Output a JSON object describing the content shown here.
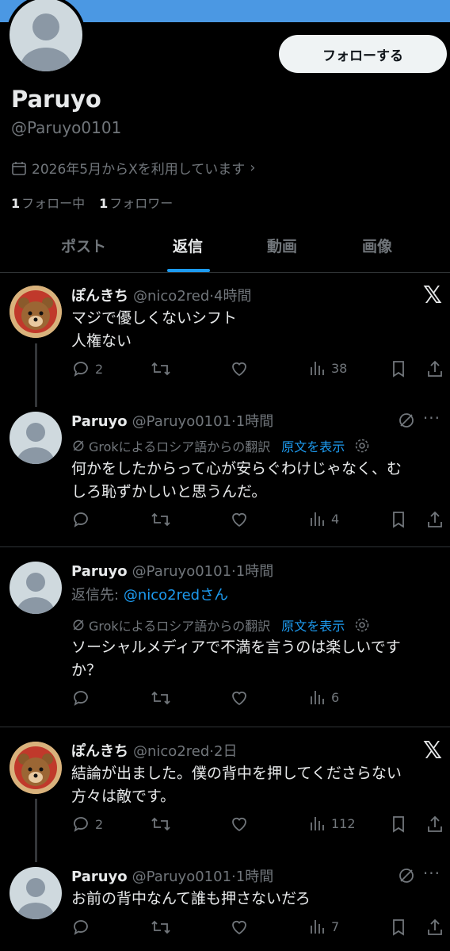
{
  "profile": {
    "follow_label": "フォローする",
    "display_name": "Paruyo",
    "handle": "@Paruyo0101",
    "joined": "2026年5月からXを利用しています",
    "following_count": "1",
    "following_label": "フォロー中",
    "followers_count": "1",
    "followers_label": "フォロワー"
  },
  "tabs": [
    "ポスト",
    "返信",
    "動画",
    "画像"
  ],
  "active_tab": "返信",
  "translation": {
    "note": "Grokによるロシア語からの翻訳",
    "show_original": "原文を表示"
  },
  "posts": [
    {
      "name": "ぽんきち",
      "handle": "@nico2red",
      "time": "4時間",
      "text": [
        "マジで優しくないシフト",
        "人権ない"
      ],
      "replies": "2",
      "views": "38"
    },
    {
      "name": "Paruyo",
      "handle": "@Paruyo0101",
      "time": "1時間",
      "text": [
        "何かをしたからって心が安らぐわけじゃなく、む",
        "しろ恥ずかしいと思うんだ。"
      ],
      "replies": "",
      "views": "4"
    },
    {
      "name": "Paruyo",
      "handle": "@Paruyo0101",
      "time": "1時間",
      "reply_to_label": "返信先:",
      "reply_to_handle": "@nico2red",
      "reply_to_suffix": "さん",
      "text": [
        "ソーシャルメディアで不満を言うのは楽しいです",
        "か？"
      ],
      "replies": "",
      "views": "6"
    },
    {
      "name": "ぽんきち",
      "handle": "@nico2red",
      "time": "2日",
      "text": [
        "結論が出ました。僕の背中を押してくださらない",
        "方々は敵です。"
      ],
      "replies": "2",
      "views": "112"
    },
    {
      "name": "Paruyo",
      "handle": "@Paruyo0101",
      "time": "1時間",
      "text": [
        "お前の背中なんて誰も押さないだろ"
      ],
      "replies": "",
      "views": "7"
    }
  ],
  "colors": {
    "accent": "#1d9bf0",
    "banner": "#4b98e3",
    "muted": "#71767b",
    "text": "#e7e9ea"
  }
}
